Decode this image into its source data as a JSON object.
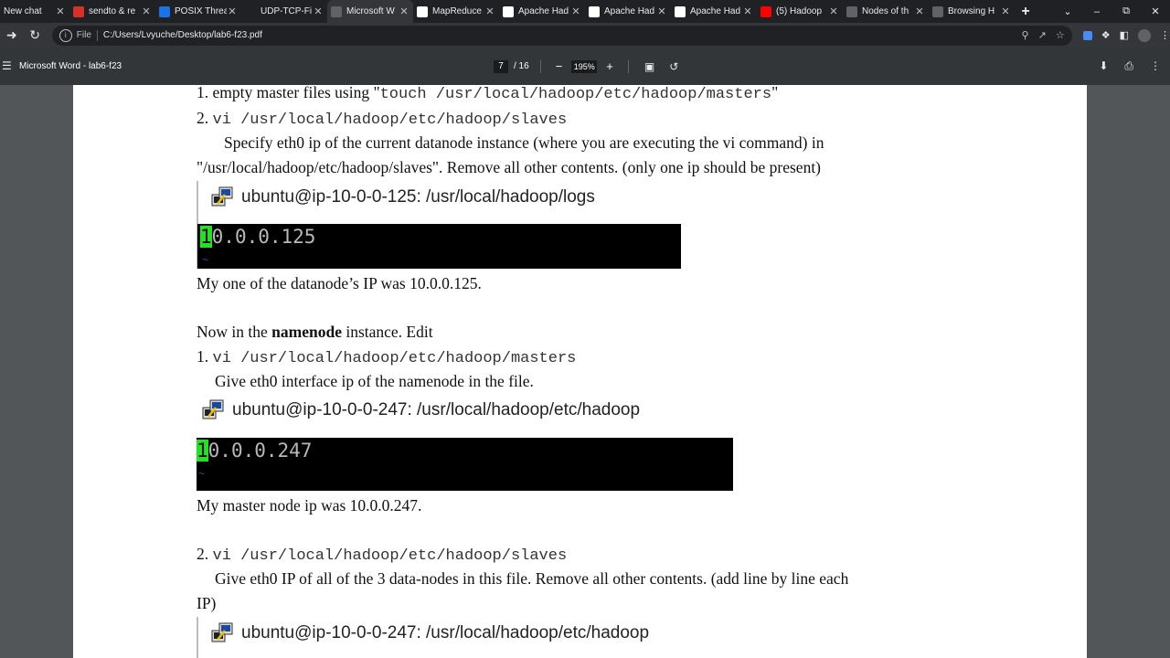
{
  "browser": {
    "tabs": [
      {
        "title": "New chat",
        "icon": "chat-icon",
        "color": "#202124"
      },
      {
        "title": "sendto & re",
        "icon": "c-icon",
        "color": "#d93025"
      },
      {
        "title": "POSIX Threa",
        "icon": "doc-icon",
        "color": "#1a73e8"
      },
      {
        "title": "UDP-TCP-Fi",
        "icon": "github-icon",
        "color": "#202124"
      },
      {
        "title": "Microsoft W",
        "icon": "globe-icon",
        "color": "#5f6368",
        "active": true
      },
      {
        "title": "MapReduce",
        "icon": "wikipedia-icon",
        "color": "#ffffff"
      },
      {
        "title": "Apache Had",
        "icon": "apache-icon",
        "color": "#ffffff"
      },
      {
        "title": "Apache Had",
        "icon": "apache-icon",
        "color": "#ffffff"
      },
      {
        "title": "Apache Had",
        "icon": "apache-icon",
        "color": "#ffffff"
      },
      {
        "title": "(5) Hadoop",
        "icon": "youtube-icon",
        "color": "#ff0000"
      },
      {
        "title": "Nodes of th",
        "icon": "globe-icon",
        "color": "#5f6368"
      },
      {
        "title": "Browsing H",
        "icon": "globe-icon",
        "color": "#5f6368"
      }
    ],
    "scheme": "File",
    "url": "C:/Users/Lvyuche/Desktop/lab6-f23.pdf"
  },
  "pdf_toolbar": {
    "doc_title": "Microsoft Word - lab6-f23",
    "current_page": "7",
    "total_pages": "/ 16",
    "zoom": "195%"
  },
  "document": {
    "line1_prefix": "1. empty master files using \"",
    "line1_code": "touch /usr/local/hadoop/etc/hadoop/masters",
    "line1_suffix": "\"",
    "line2_prefix": "2. ",
    "line2_code": "vi /usr/local/hadoop/etc/hadoop/slaves",
    "para1_a": "Specify eth0 ip of the current datanode instance (where you are executing the vi command) in",
    "para1_b": "\"/usr/local/hadoop/etc/hadoop/slaves\". Remove all other contents. (only one ip should be present)",
    "term1_title": "ubuntu@ip-10-0-0-125: /usr/local/hadoop/logs",
    "term1_cursor": "1",
    "term1_rest": "0.0.0.125",
    "caption1": "My one of the datanode’s IP was 10.0.0.125.",
    "now_prefix": "Now in the ",
    "now_bold": "namenode",
    "now_suffix": " instance. Edit",
    "nn1_prefix": "1. ",
    "nn1_code": "vi /usr/local/hadoop/etc/hadoop/masters",
    "nn1_desc": "Give eth0 interface ip of the namenode in the file.",
    "term2_title": "ubuntu@ip-10-0-0-247: /usr/local/hadoop/etc/hadoop",
    "term2_cursor": "1",
    "term2_rest": "0.0.0.247",
    "caption2": "My master node ip was 10.0.0.247.",
    "nn2_prefix": "2. ",
    "nn2_code": "vi /usr/local/hadoop/etc/hadoop/slaves",
    "nn2_desc_a": "Give eth0 IP of all of the 3 data-nodes in this file. Remove all other contents. (add line by line each",
    "nn2_desc_b": "IP)",
    "term3_title": "ubuntu@ip-10-0-0-247: /usr/local/hadoop/etc/hadoop",
    "tilde": "~"
  }
}
